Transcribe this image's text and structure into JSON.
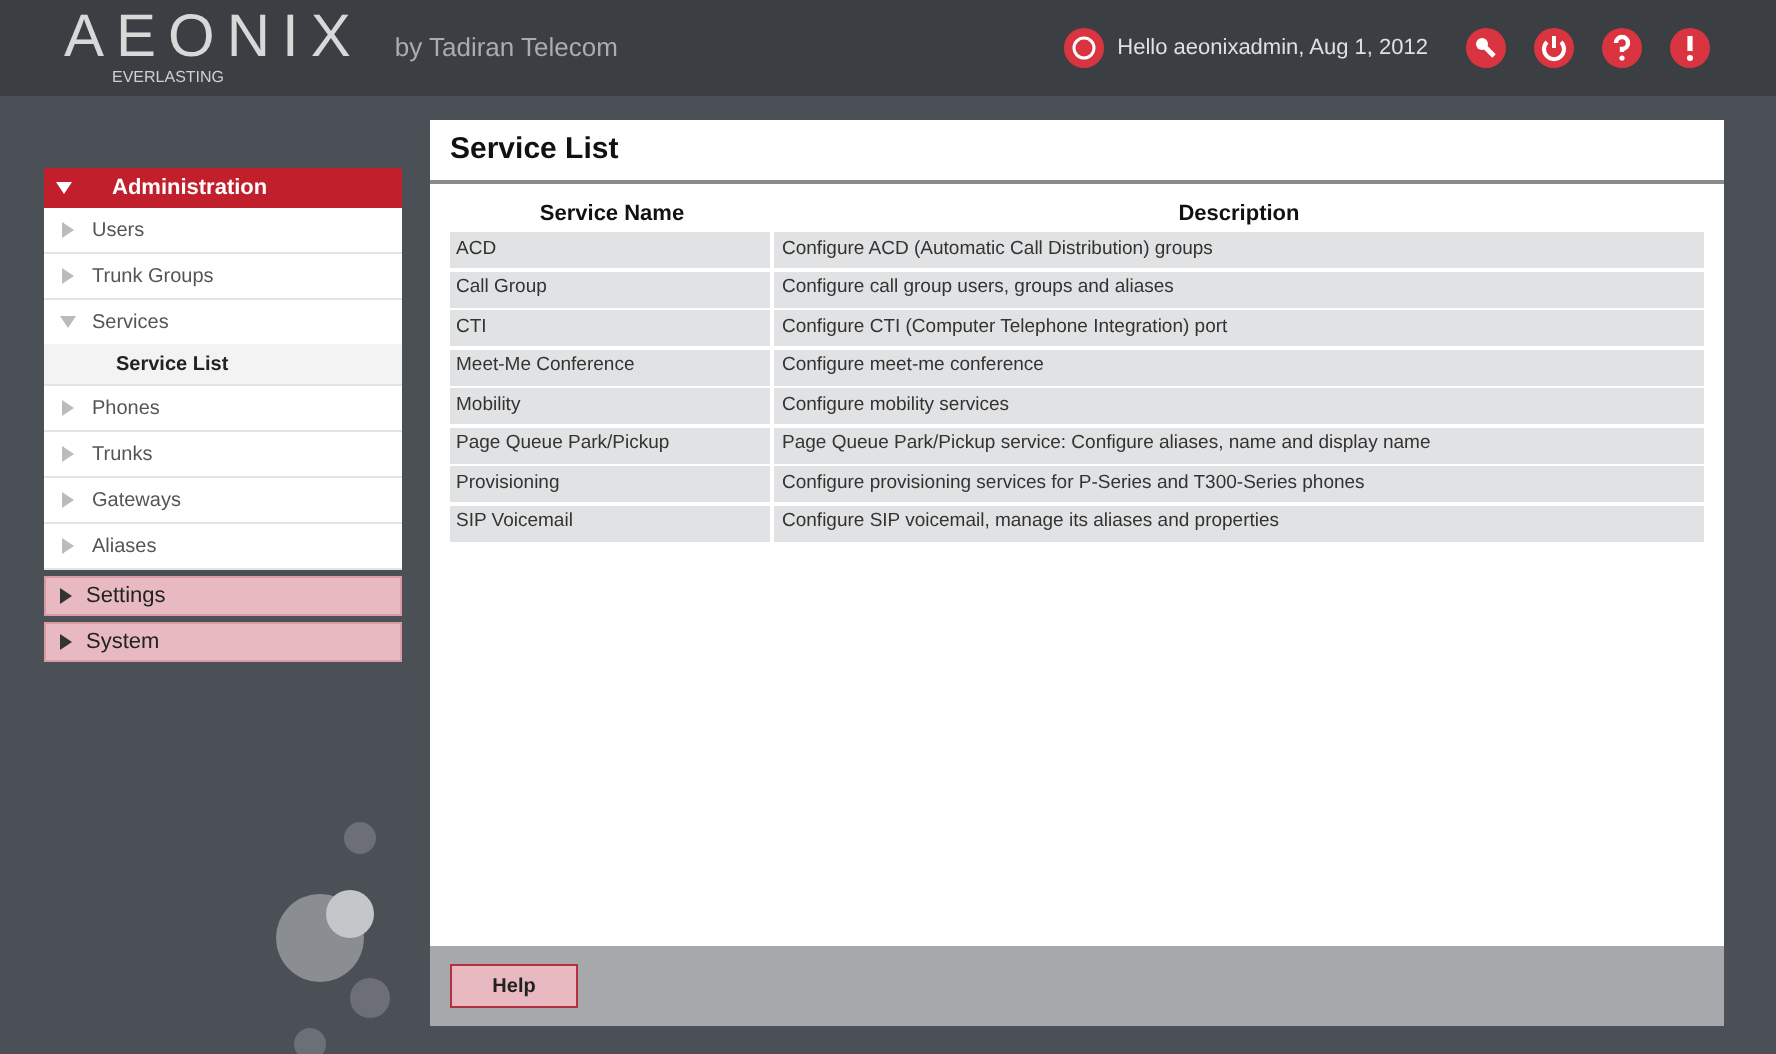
{
  "header": {
    "logo": "AEONIX",
    "logo_tagline": "EVERLASTING",
    "byline": "by Tadiran Telecom",
    "greeting": "Hello aeonixadmin, Aug 1, 2012"
  },
  "sidebar": {
    "sections": [
      {
        "label": "Administration",
        "expanded": true,
        "items": [
          {
            "label": "Users",
            "expanded": false
          },
          {
            "label": "Trunk Groups",
            "expanded": false
          },
          {
            "label": "Services",
            "expanded": true,
            "children": [
              {
                "label": "Service List",
                "selected": true
              }
            ]
          },
          {
            "label": "Phones",
            "expanded": false
          },
          {
            "label": "Trunks",
            "expanded": false
          },
          {
            "label": "Gateways",
            "expanded": false
          },
          {
            "label": "Aliases",
            "expanded": false
          }
        ]
      },
      {
        "label": "Settings",
        "expanded": false
      },
      {
        "label": "System",
        "expanded": false
      }
    ]
  },
  "main": {
    "title": "Service List",
    "table": {
      "columns": [
        "Service Name",
        "Description"
      ],
      "rows": [
        [
          "ACD",
          "Configure ACD (Automatic Call Distribution) groups"
        ],
        [
          "Call Group",
          "Configure call group users, groups and aliases"
        ],
        [
          "CTI",
          "Configure CTI (Computer Telephone Integration) port"
        ],
        [
          "Meet-Me Conference",
          "Configure meet-me conference"
        ],
        [
          "Mobility",
          "Configure mobility services"
        ],
        [
          "Page Queue Park/Pickup",
          "Page Queue Park/Pickup service: Configure aliases, name and display name"
        ],
        [
          "Provisioning",
          "Configure provisioning services for P-Series and T300-Series phones"
        ],
        [
          "SIP Voicemail",
          "Configure SIP voicemail, manage its aliases and properties"
        ]
      ]
    },
    "footer_button": "Help"
  }
}
